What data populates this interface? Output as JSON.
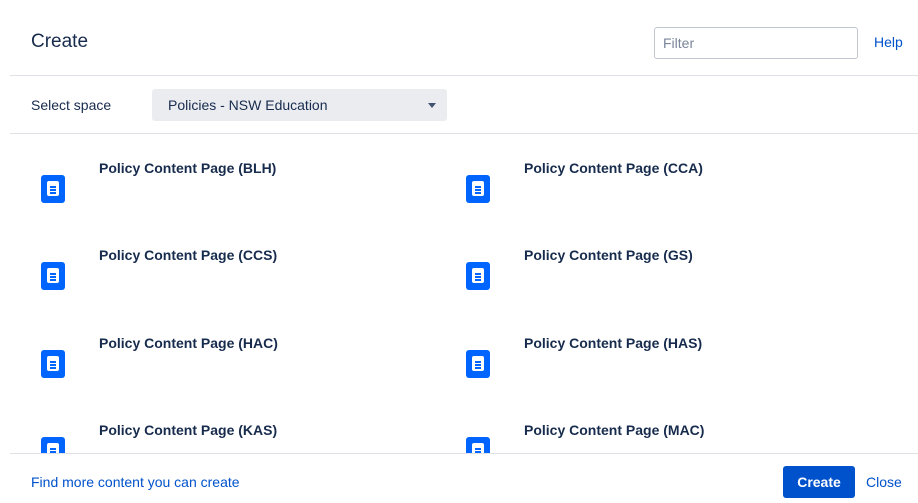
{
  "dialog": {
    "title": "Create",
    "filter_placeholder": "Filter",
    "help_label": "Help"
  },
  "space": {
    "label": "Select space",
    "selected": "Policies - NSW Education"
  },
  "templates": [
    {
      "name": "Policy Content Page (BLH)",
      "icon": "page-template-icon"
    },
    {
      "name": "Policy Content Page (CCA)",
      "icon": "page-template-icon"
    },
    {
      "name": "Policy Content Page (CCS)",
      "icon": "page-template-icon"
    },
    {
      "name": "Policy Content Page (GS)",
      "icon": "page-template-icon"
    },
    {
      "name": "Policy Content Page (HAC)",
      "icon": "page-template-icon"
    },
    {
      "name": "Policy Content Page (HAS)",
      "icon": "page-template-icon"
    },
    {
      "name": "Policy Content Page (KAS)",
      "icon": "page-template-icon"
    },
    {
      "name": "Policy Content Page (MAC)",
      "icon": "page-template-icon"
    }
  ],
  "footer": {
    "more_link": "Find more content you can create",
    "create_label": "Create",
    "close_label": "Close"
  },
  "colors": {
    "accent": "#0052cc",
    "icon_blue": "#0065ff",
    "select_bg": "#ebecf0"
  }
}
